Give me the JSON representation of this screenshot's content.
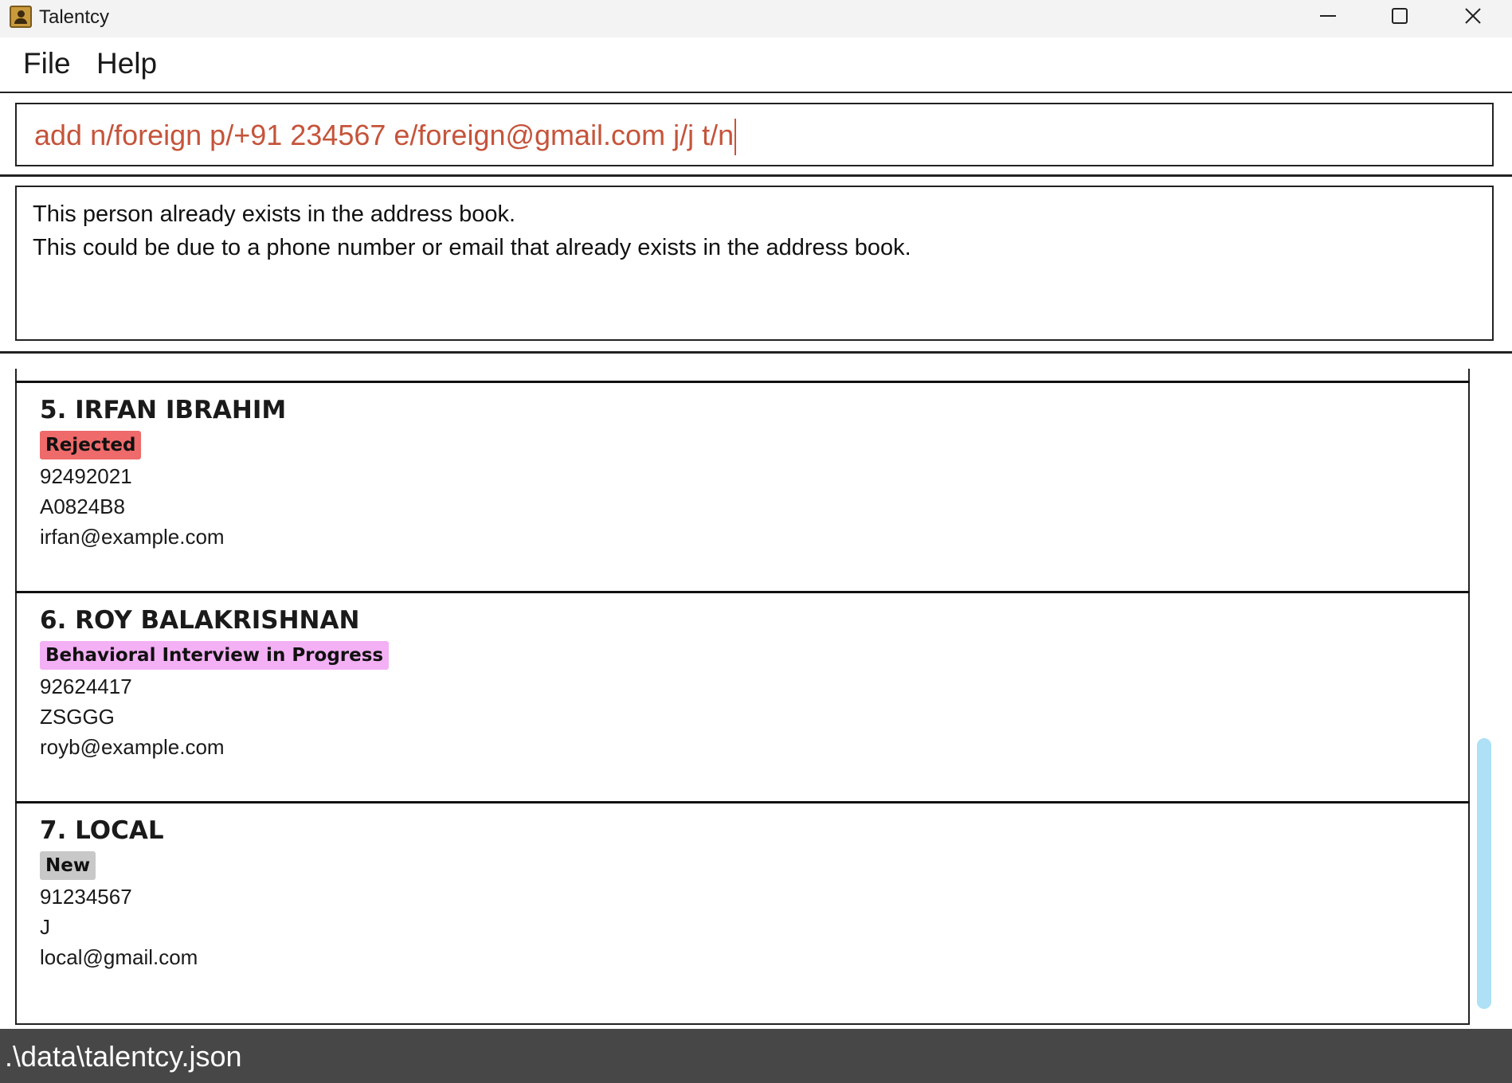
{
  "window": {
    "title": "Talentcy"
  },
  "menu": {
    "items": [
      "File",
      "Help"
    ]
  },
  "command": {
    "value": "add n/foreign p/+91 234567 e/foreign@gmail.com j/j t/n",
    "text_color": "#c5543b"
  },
  "result": {
    "lines": [
      "This person already exists in the address book.",
      "This could be due to a phone number or email that already exists in the address book."
    ]
  },
  "persons": [
    {
      "name": "5. IRFAN IBRAHIM",
      "status": "Rejected",
      "status_color": "#ef6a6a",
      "phone": "92492021",
      "job": "A0824B8",
      "email": "irfan@example.com"
    },
    {
      "name": "6. ROY BALAKRISHNAN",
      "status": "Behavioral Interview in Progress",
      "status_color": "#f4b0f4",
      "phone": "92624417",
      "job": "ZSGGG",
      "email": "royb@example.com"
    },
    {
      "name": "7. LOCAL",
      "status": "New",
      "status_color": "#c8c8c8",
      "phone": "91234567",
      "job": "J",
      "email": "local@gmail.com"
    }
  ],
  "status_bar": {
    "path": ".\\data\\talentcy.json"
  },
  "icons": {
    "app": "contact-book-icon",
    "minimize": "minimize-icon",
    "maximize": "maximize-icon",
    "close": "close-icon"
  }
}
